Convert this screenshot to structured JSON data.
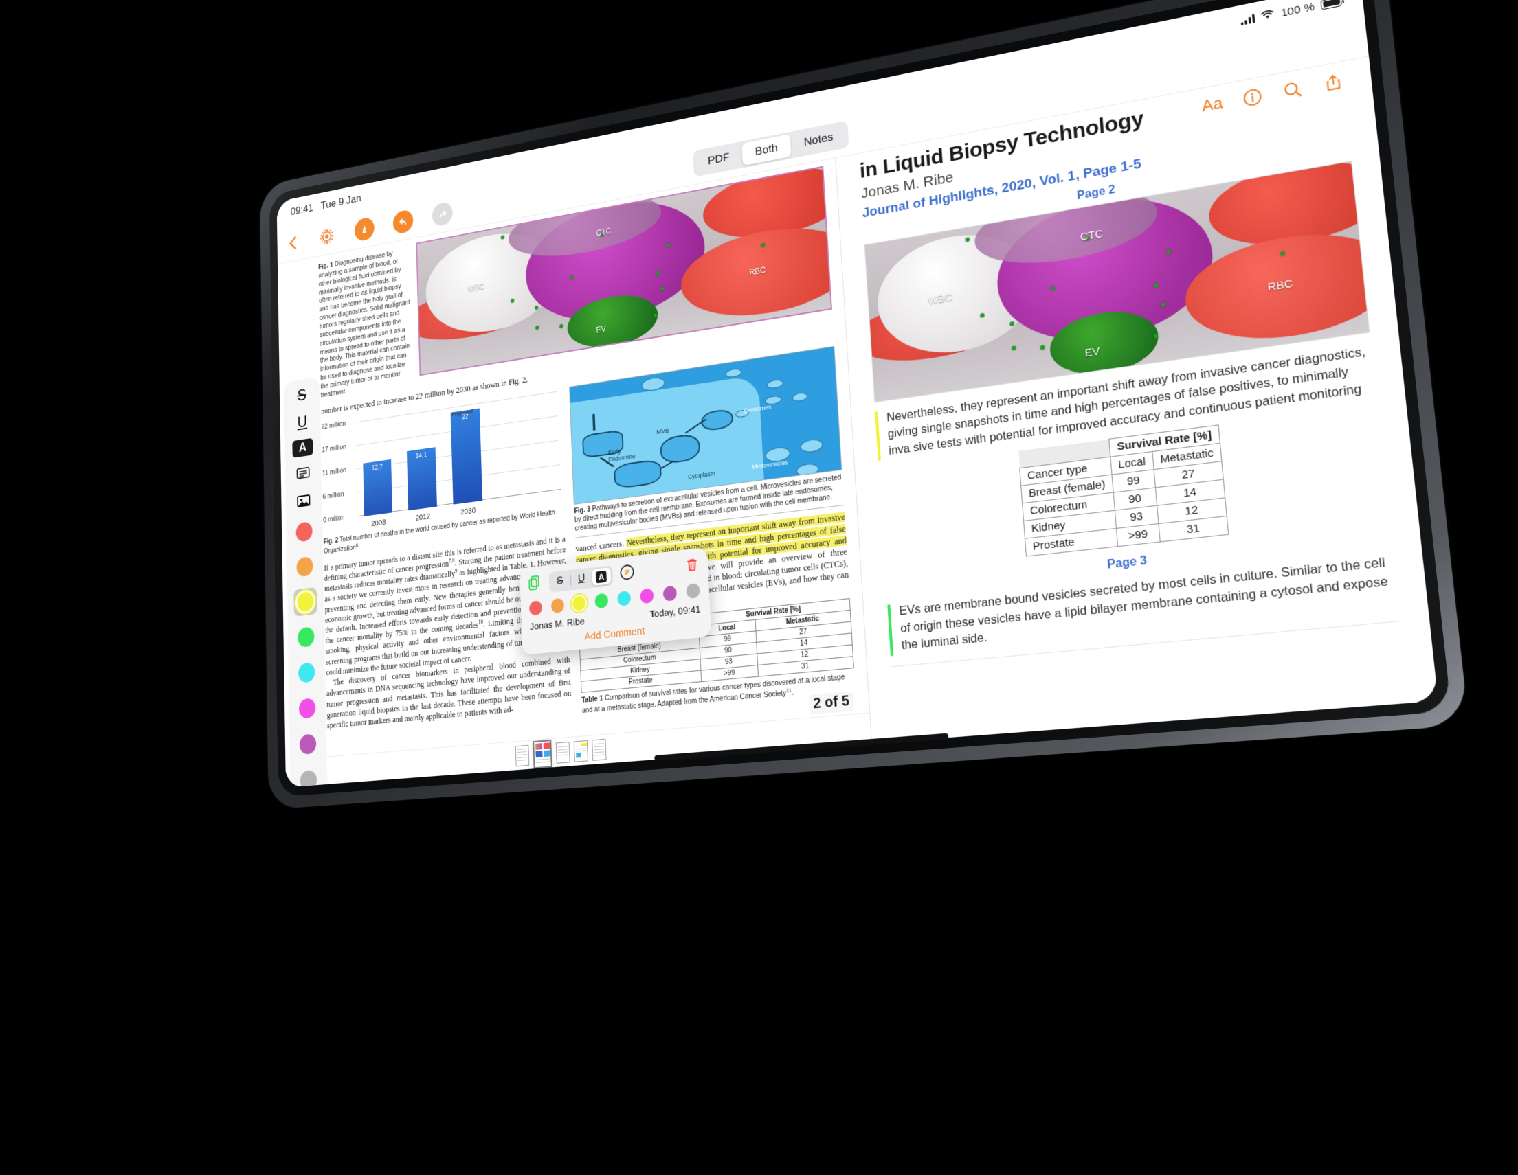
{
  "status_bar": {
    "time": "09:41",
    "date": "Tue 9 Jan",
    "battery_percent": "100 %"
  },
  "navbar": {
    "back_icon": "chevron-left-icon",
    "settings_icon": "gear-icon",
    "annotate_icon": "highlighter-icon",
    "undo_icon": "undo-icon",
    "redo_icon": "redo-icon"
  },
  "view_switcher": {
    "options": [
      "PDF",
      "Both",
      "Notes"
    ],
    "selected": "Both"
  },
  "annotation_toolbar": {
    "tools": [
      {
        "name": "strikethrough-tool",
        "label": "S",
        "selected": false
      },
      {
        "name": "underline-tool",
        "label": "U",
        "selected": false
      },
      {
        "name": "highlight-tool",
        "label": "A",
        "selected": true
      },
      {
        "name": "comment-tool",
        "label": "comment-icon",
        "selected": false
      },
      {
        "name": "image-tool",
        "label": "image-icon",
        "selected": false
      }
    ],
    "colors": [
      {
        "name": "red",
        "hex": "#f4645f",
        "selected": false
      },
      {
        "name": "orange",
        "hex": "#f5a349",
        "selected": false
      },
      {
        "name": "yellow",
        "hex": "#f2f23a",
        "selected": true
      },
      {
        "name": "green",
        "hex": "#35e860",
        "selected": false
      },
      {
        "name": "cyan",
        "hex": "#3fe8ef",
        "selected": false
      },
      {
        "name": "magenta",
        "hex": "#f24fe8",
        "selected": false
      },
      {
        "name": "purple",
        "hex": "#b95ab9",
        "selected": false
      },
      {
        "name": "gray",
        "hex": "#b5b5b7",
        "selected": false
      }
    ],
    "redo_enabled": false,
    "undo_enabled": true
  },
  "pdf": {
    "fig1_caption": "Diagnosing disease by analyzing a sample of blood, or other biological fluid obtained by minimally invasive methods, is often referred to as liquid biopsy and has become the holy grail of cancer diagnostics. Solid malignant tumors regularly shed cells and subcellular components into the circulation system and use it as a means to spread to other parts of the body. This material can contain information of their origin that can be used to diagnose and localize the primary tumor or to monitor treatment.",
    "fig1_label": "Fig. 1",
    "fig1_image_labels": [
      "WBC",
      "CTC",
      "RBC",
      "EV"
    ],
    "intro_line": "number is expected to increase to 22 million by 2030 as shown in Fig. 2.",
    "fig2_label": "Fig. 2",
    "fig2_caption": "Total number of deaths in the world caused by cancer as reported by World Health Organization",
    "fig2_caption_sup": "6",
    "fig3_label": "Fig. 3",
    "fig3_caption": "Pathways to secretion of extracellular vesicles from a cell. Microvesicles are secreted by direct budding from the cell membrane. Exosomes are formed inside late endosomes, creating multivesicular bodies (MVBs) and released upon fusion with the cell membrane.",
    "fig3_diagram_labels": [
      "Exosomes",
      "MVB",
      "Early Endosome",
      "Cytoplasm",
      "Microvesicles"
    ],
    "left_col_paragraph_1": "If a primary tumor spreads to a distant site this is referred to as metastasis and it is a defining characteristic of cancer progression",
    "left_col_sup_1": "7,8",
    "left_col_paragraph_1b": ". Starting the patient treatment before metastasis reduces mortality rates dramatically",
    "left_col_sup_2": "9",
    "left_col_paragraph_1c": " as highlighted in Table. 1. However, as a society we currently invest more in research on treating advanced cancers than preventing and detecting them early. New therapies generally benefit society and economic growth, but treating advanced forms of cancer should be our last resort not the default. Increased efforts towards early detection and prevention might reduce the cancer mortality by 75% in the coming decades",
    "left_col_sup_3": "10",
    "left_col_paragraph_1d": ". Limiting the risks of diet, smoking, physical activity and other environmental factors while developing screening programs that build on our increasing understanding of tumor progression could minimize the future societal impact of cancer.",
    "left_col_paragraph_2": "The discovery of cancer biomarkers in peripheral blood combined with advancements in DNA sequencing technology have improved our understanding of tumor progression and metastasis. This has facilitated the development of first generation liquid biopsies in the last decade. These attempts have been focused on specific tumor markers and mainly applicable to patients with ad-",
    "right_col_lead": "vanced cancers. ",
    "right_col_highlight": "Nevertheless, they represent an important shift away from invasive cancer diagnostics, giving single snapshots in time and high percentages of false positives, to minimally invasive tests with potential for improved accuracy and continuous patient monitoring.",
    "right_col_tail": " Here, we will provide an overview of three promising circulating tumor markers found in blood: circulating tumor cells (CTCs), circulating tumor DNA (ctDNA) and extracellular vesicles (EVs), and how they can be used for diagnosis of cancer.",
    "table1_label": "Table 1",
    "table1_caption": "Comparison of survival rates for various cancer types discovered at a local stage and at a metastatic stage. Adapted from the American Cancer Society",
    "table1_caption_sup": "11",
    "page_indicator": "2 of 5",
    "thumbnail_count": 5,
    "current_thumbnail": 2
  },
  "chart_data": {
    "type": "bar",
    "title": "",
    "categories": [
      "2008",
      "2012",
      "2030"
    ],
    "values": [
      12.7,
      14.1,
      22
    ],
    "value_labels": [
      "12,7",
      "14,1",
      "22"
    ],
    "annotations": [
      "",
      "",
      "Projected"
    ],
    "ytick_labels": [
      "0 million",
      "6 million",
      "11 million",
      "17 million",
      "22 million"
    ],
    "ytick_values": [
      0,
      6,
      11,
      17,
      22
    ],
    "ylim": [
      0,
      23.5
    ],
    "xlabel": "",
    "ylabel": "",
    "grid": true,
    "legend": "none",
    "bar_color": "#2562c9"
  },
  "notes": {
    "title": "in Liquid Biopsy Technology",
    "author": "Jonas M. Ribe",
    "journal": "Journal of Highlights, 2020, Vol. 1, Page 1-5",
    "icons": [
      {
        "name": "text-size-icon",
        "glyph": "Aa"
      },
      {
        "name": "info-icon",
        "glyph": "i"
      },
      {
        "name": "search-icon",
        "glyph": "search"
      },
      {
        "name": "share-icon",
        "glyph": "share"
      }
    ],
    "sections": [
      {
        "page_label": "Page 2",
        "image_labels": [
          "WBC",
          "CTC",
          "RBC",
          "EV"
        ],
        "highlight_color": "#f2f23a",
        "highlight_text": "Nevertheless, they represent an important shift away from invasive cancer diagnostics, giving single snapshots in time and high percentages of false positives, to minimally inva sive tests with potential for improved accuracy and continuous patient monitoring"
      },
      {
        "page_label": "Page 3",
        "highlight_color": "#35e860",
        "highlight_text": "EVs are membrane bound vesicles secreted by most cells in culture. Similar to the cell of origin these vesicles have a lipid bilayer membrane containing a cytosol and expose the luminal side."
      }
    ],
    "table": {
      "group_header": "Survival Rate [%]",
      "headers": [
        "Cancer type",
        "Local",
        "Metastatic"
      ],
      "rows": [
        [
          "Breast (female)",
          "99",
          "27"
        ],
        [
          "Colorectum",
          "90",
          "14"
        ],
        [
          "Kidney",
          "93",
          "12"
        ],
        [
          "Prostate",
          ">99",
          "31"
        ]
      ]
    }
  },
  "annotation_popup": {
    "copy_icon": "copy-icon",
    "tools": [
      {
        "name": "strikethrough-button",
        "label": "S",
        "selected": false
      },
      {
        "name": "underline-button",
        "label": "U",
        "selected": false
      },
      {
        "name": "highlight-button",
        "label": "A",
        "selected": true
      }
    ],
    "link_icon": "link-icon",
    "delete_icon": "trash-icon",
    "colors": [
      {
        "name": "red",
        "hex": "#f4645f",
        "selected": false
      },
      {
        "name": "orange",
        "hex": "#f5a349",
        "selected": false
      },
      {
        "name": "yellow",
        "hex": "#f2f23a",
        "selected": true
      },
      {
        "name": "green",
        "hex": "#35e860",
        "selected": false
      },
      {
        "name": "cyan",
        "hex": "#3fe8ef",
        "selected": false
      },
      {
        "name": "magenta",
        "hex": "#f24fe8",
        "selected": false
      },
      {
        "name": "purple",
        "hex": "#b95ab9",
        "selected": false
      },
      {
        "name": "gray",
        "hex": "#b5b5b7",
        "selected": false
      }
    ],
    "author": "Jonas M. Ribe",
    "timestamp": "Today, 09:41",
    "add_comment_label": "Add Comment"
  },
  "theme": {
    "accent": "#f07c23",
    "link_blue": "#3f6fd0",
    "highlight_yellow": "#f7f06a"
  }
}
